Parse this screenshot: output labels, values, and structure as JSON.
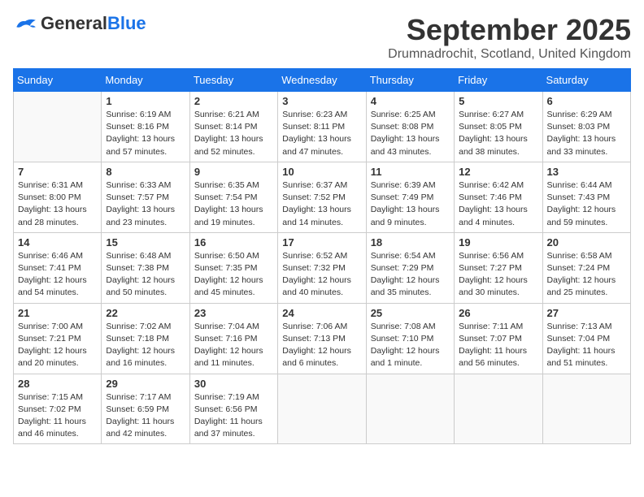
{
  "header": {
    "logo_general": "General",
    "logo_blue": "Blue",
    "month": "September 2025",
    "location": "Drumnadrochit, Scotland, United Kingdom"
  },
  "weekdays": [
    "Sunday",
    "Monday",
    "Tuesday",
    "Wednesday",
    "Thursday",
    "Friday",
    "Saturday"
  ],
  "weeks": [
    [
      {
        "day": "",
        "info": ""
      },
      {
        "day": "1",
        "info": "Sunrise: 6:19 AM\nSunset: 8:16 PM\nDaylight: 13 hours\nand 57 minutes."
      },
      {
        "day": "2",
        "info": "Sunrise: 6:21 AM\nSunset: 8:14 PM\nDaylight: 13 hours\nand 52 minutes."
      },
      {
        "day": "3",
        "info": "Sunrise: 6:23 AM\nSunset: 8:11 PM\nDaylight: 13 hours\nand 47 minutes."
      },
      {
        "day": "4",
        "info": "Sunrise: 6:25 AM\nSunset: 8:08 PM\nDaylight: 13 hours\nand 43 minutes."
      },
      {
        "day": "5",
        "info": "Sunrise: 6:27 AM\nSunset: 8:05 PM\nDaylight: 13 hours\nand 38 minutes."
      },
      {
        "day": "6",
        "info": "Sunrise: 6:29 AM\nSunset: 8:03 PM\nDaylight: 13 hours\nand 33 minutes."
      }
    ],
    [
      {
        "day": "7",
        "info": "Sunrise: 6:31 AM\nSunset: 8:00 PM\nDaylight: 13 hours\nand 28 minutes."
      },
      {
        "day": "8",
        "info": "Sunrise: 6:33 AM\nSunset: 7:57 PM\nDaylight: 13 hours\nand 23 minutes."
      },
      {
        "day": "9",
        "info": "Sunrise: 6:35 AM\nSunset: 7:54 PM\nDaylight: 13 hours\nand 19 minutes."
      },
      {
        "day": "10",
        "info": "Sunrise: 6:37 AM\nSunset: 7:52 PM\nDaylight: 13 hours\nand 14 minutes."
      },
      {
        "day": "11",
        "info": "Sunrise: 6:39 AM\nSunset: 7:49 PM\nDaylight: 13 hours\nand 9 minutes."
      },
      {
        "day": "12",
        "info": "Sunrise: 6:42 AM\nSunset: 7:46 PM\nDaylight: 13 hours\nand 4 minutes."
      },
      {
        "day": "13",
        "info": "Sunrise: 6:44 AM\nSunset: 7:43 PM\nDaylight: 12 hours\nand 59 minutes."
      }
    ],
    [
      {
        "day": "14",
        "info": "Sunrise: 6:46 AM\nSunset: 7:41 PM\nDaylight: 12 hours\nand 54 minutes."
      },
      {
        "day": "15",
        "info": "Sunrise: 6:48 AM\nSunset: 7:38 PM\nDaylight: 12 hours\nand 50 minutes."
      },
      {
        "day": "16",
        "info": "Sunrise: 6:50 AM\nSunset: 7:35 PM\nDaylight: 12 hours\nand 45 minutes."
      },
      {
        "day": "17",
        "info": "Sunrise: 6:52 AM\nSunset: 7:32 PM\nDaylight: 12 hours\nand 40 minutes."
      },
      {
        "day": "18",
        "info": "Sunrise: 6:54 AM\nSunset: 7:29 PM\nDaylight: 12 hours\nand 35 minutes."
      },
      {
        "day": "19",
        "info": "Sunrise: 6:56 AM\nSunset: 7:27 PM\nDaylight: 12 hours\nand 30 minutes."
      },
      {
        "day": "20",
        "info": "Sunrise: 6:58 AM\nSunset: 7:24 PM\nDaylight: 12 hours\nand 25 minutes."
      }
    ],
    [
      {
        "day": "21",
        "info": "Sunrise: 7:00 AM\nSunset: 7:21 PM\nDaylight: 12 hours\nand 20 minutes."
      },
      {
        "day": "22",
        "info": "Sunrise: 7:02 AM\nSunset: 7:18 PM\nDaylight: 12 hours\nand 16 minutes."
      },
      {
        "day": "23",
        "info": "Sunrise: 7:04 AM\nSunset: 7:16 PM\nDaylight: 12 hours\nand 11 minutes."
      },
      {
        "day": "24",
        "info": "Sunrise: 7:06 AM\nSunset: 7:13 PM\nDaylight: 12 hours\nand 6 minutes."
      },
      {
        "day": "25",
        "info": "Sunrise: 7:08 AM\nSunset: 7:10 PM\nDaylight: 12 hours\nand 1 minute."
      },
      {
        "day": "26",
        "info": "Sunrise: 7:11 AM\nSunset: 7:07 PM\nDaylight: 11 hours\nand 56 minutes."
      },
      {
        "day": "27",
        "info": "Sunrise: 7:13 AM\nSunset: 7:04 PM\nDaylight: 11 hours\nand 51 minutes."
      }
    ],
    [
      {
        "day": "28",
        "info": "Sunrise: 7:15 AM\nSunset: 7:02 PM\nDaylight: 11 hours\nand 46 minutes."
      },
      {
        "day": "29",
        "info": "Sunrise: 7:17 AM\nSunset: 6:59 PM\nDaylight: 11 hours\nand 42 minutes."
      },
      {
        "day": "30",
        "info": "Sunrise: 7:19 AM\nSunset: 6:56 PM\nDaylight: 11 hours\nand 37 minutes."
      },
      {
        "day": "",
        "info": ""
      },
      {
        "day": "",
        "info": ""
      },
      {
        "day": "",
        "info": ""
      },
      {
        "day": "",
        "info": ""
      }
    ]
  ]
}
